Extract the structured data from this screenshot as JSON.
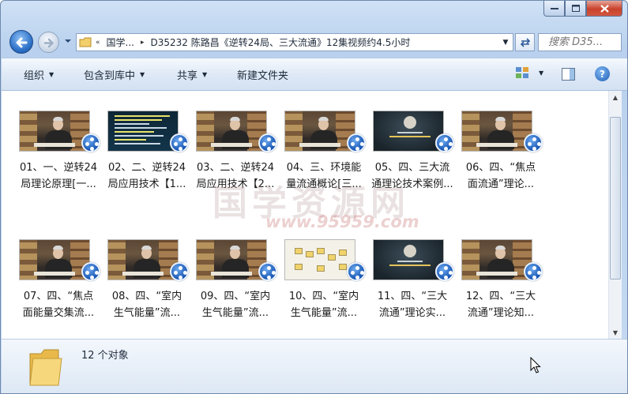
{
  "nav": {
    "back_label": "",
    "forward_label": ""
  },
  "address": {
    "crumbs": [
      "国学...",
      "D35232 陈路昌《逆转24局、三大流通》12集视频约4.5小时"
    ]
  },
  "search": {
    "placeholder": "搜索 D35..."
  },
  "toolbar": {
    "organize": "组织",
    "include_library": "包含到库中",
    "share": "共享",
    "new_folder": "新建文件夹"
  },
  "files": [
    {
      "line1": "01、一、逆转24",
      "line2": "局理论原理[一...",
      "thumb": "man"
    },
    {
      "line1": "02、二、逆转24",
      "line2": "局应用技术【1...",
      "thumb": "slide"
    },
    {
      "line1": "03、二、逆转24",
      "line2": "局应用技术【2...",
      "thumb": "man"
    },
    {
      "line1": "04、三、环境能",
      "line2": "量流通概论[三...",
      "thumb": "man"
    },
    {
      "line1": "05、四、三大流",
      "line2": "通理论技术案例...",
      "thumb": "dark"
    },
    {
      "line1": "06、四、“焦点",
      "line2": "面流通”理论...",
      "thumb": "man"
    },
    {
      "line1": "07、四、“焦点",
      "line2": "面能量交集流...",
      "thumb": "man"
    },
    {
      "line1": "08、四、“室内",
      "line2": "生气能量”流...",
      "thumb": "man"
    },
    {
      "line1": "09、四、“室内",
      "line2": "生气能量”流...",
      "thumb": "man"
    },
    {
      "line1": "10、四、“室内",
      "line2": "生气能量”流...",
      "thumb": "chart"
    },
    {
      "line1": "11、四、“三大",
      "line2": "流通”理论实...",
      "thumb": "dark"
    },
    {
      "line1": "12、四、“三大",
      "line2": "流通”理论知...",
      "thumb": "man"
    }
  ],
  "watermark": {
    "text": "国学资源网",
    "url": "www.95959.com"
  },
  "details": {
    "count_text": "12 个对象"
  },
  "colors": {
    "accent": "#1756b4",
    "close_button": "#c8422b"
  }
}
